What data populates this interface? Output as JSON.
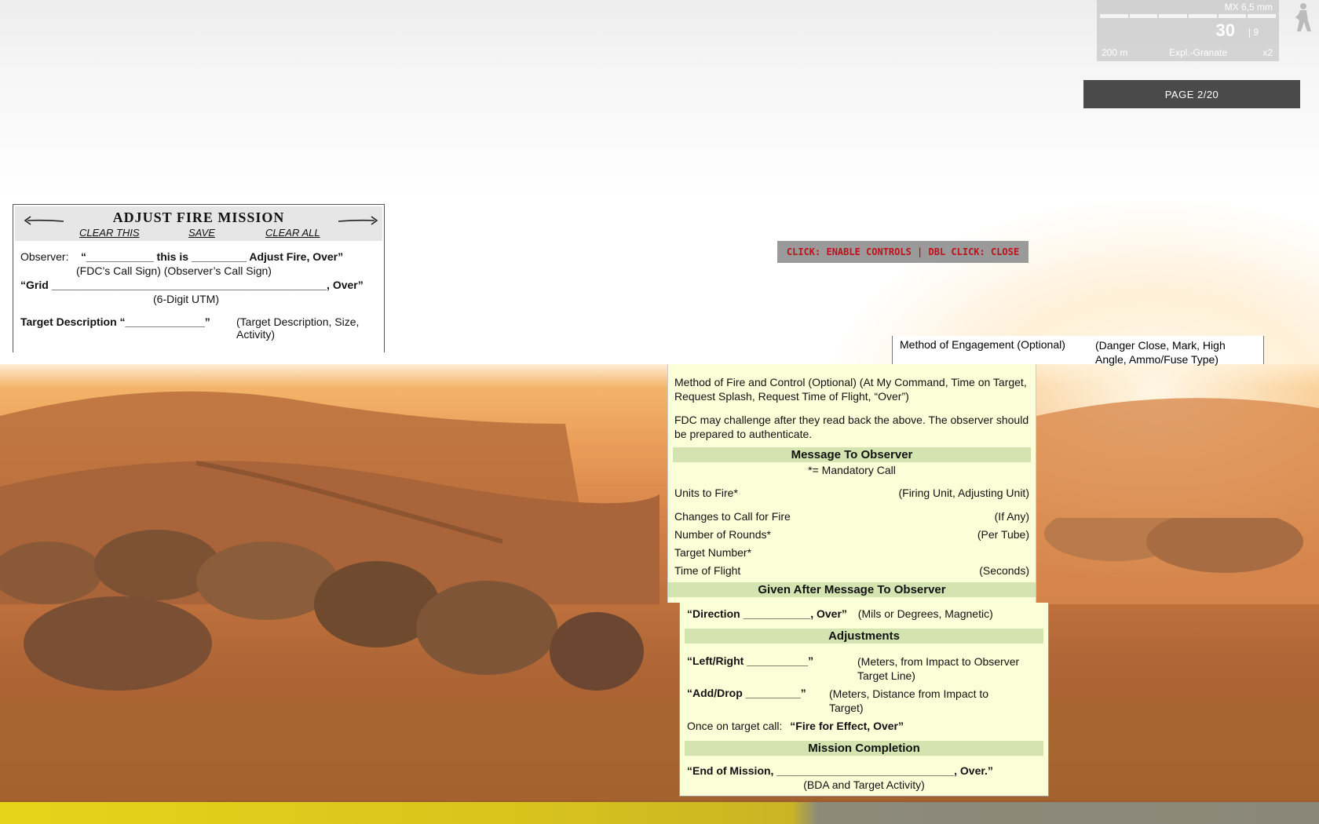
{
  "hud": {
    "weapon_name": "MX 6,5 mm",
    "ammo": "30",
    "mags": "| 9",
    "range": "200 m",
    "ammo_type": "Expl.-Granate",
    "zoom": "x2"
  },
  "page_indicator": "PAGE 2/20",
  "hint": "CLICK: ENABLE CONTROLS | DBL CLICK: CLOSE",
  "top_card": {
    "title": "ADJUST FIRE MISSION",
    "clear_this": "CLEAR THIS",
    "save": "SAVE",
    "clear_all": "CLEAR ALL",
    "observer_label": "Observer:",
    "observer_call": "“___________ this is _________ Adjust Fire, Over”",
    "observer_sub": "(FDC’s Call Sign)   (Observer’s Call Sign)",
    "grid_line": "“Grid _____________________________________________, Over”",
    "grid_sub": "(6-Digit UTM)",
    "target_label": "Target Description “_____________”",
    "target_note": "(Target Description, Size, Activity)"
  },
  "fragment": {
    "label": "Method of Engagement (Optional)",
    "note": "(Danger Close, Mark, High Angle, Ammo/Fuse Type)"
  },
  "mid_card": {
    "method_fire": "Method of Fire and Control (Optional)    (At My Command, Time on Target, Request Splash, Request Time of Flight, “Over”)",
    "fdc_challenge": "FDC may challenge after they read back the above.  The observer should be prepared to authenticate.",
    "mto_head": "Message To Observer",
    "mto_sub": "*= Mandatory Call",
    "rows": [
      {
        "label": "Units to Fire*",
        "note": "(Firing Unit, Adjusting Unit)"
      },
      {
        "label": "Changes to Call for Fire",
        "note": "(If Any)"
      },
      {
        "label": "Number of Rounds*",
        "note": "(Per Tube)"
      },
      {
        "label": "Target Number*",
        "note": ""
      },
      {
        "label": "Time of Flight",
        "note": "(Seconds)"
      }
    ],
    "given_after": "Given After Message To Observer"
  },
  "bot_card": {
    "direction": "“Direction ___________, Over”",
    "direction_note": "(Mils or Degrees, Magnetic)",
    "adjustments_head": "Adjustments",
    "left_right": "“Left/Right __________”",
    "left_right_note": "(Meters, from Impact to Observer Target Line)",
    "add_drop": "“Add/Drop _________”",
    "add_drop_note": "(Meters, Distance from Impact to Target)",
    "once_on_target": "Once on target call:",
    "ffe": "“Fire for Effect, Over”",
    "completion_head": "Mission Completion",
    "eom": "“End of Mission, _____________________________, Over.”",
    "eom_note": "(BDA  and Target Activity)"
  }
}
